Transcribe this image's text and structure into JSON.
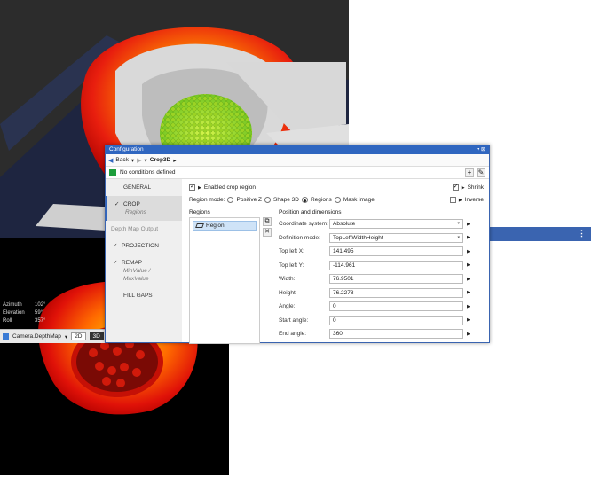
{
  "viewer": {
    "angles": [
      {
        "label": "Azimuth",
        "value": "102°"
      },
      {
        "label": "Elevation",
        "value": "59°"
      },
      {
        "label": "Roll",
        "value": "357°"
      }
    ],
    "camera_selector": "Camera.DepthMap",
    "mode_2d": "2D",
    "mode_3d": "3D",
    "active_mode": "3D"
  },
  "config": {
    "window_title": "Configuration",
    "back_label": "Back",
    "breadcrumb": "Crop3D",
    "conditions_label": "No conditions defined",
    "sidebar": [
      {
        "label": "GENERAL",
        "sub": "",
        "checked": false,
        "selected": false,
        "dim": false
      },
      {
        "label": "CROP",
        "sub": "Regions",
        "checked": true,
        "selected": true,
        "dim": false
      },
      {
        "label": "Depth Map Output",
        "sub": "",
        "checked": false,
        "selected": false,
        "dim": true
      },
      {
        "label": "PROJECTION",
        "sub": "",
        "checked": true,
        "selected": false,
        "dim": false
      },
      {
        "label": "REMAP",
        "sub": "MinValue / MaxValue",
        "checked": true,
        "selected": false,
        "dim": false
      },
      {
        "label": "FILL GAPS",
        "sub": "",
        "checked": false,
        "selected": false,
        "dim": false
      }
    ],
    "enabled_label": "Enabled crop region",
    "shrink_label": "Shrink",
    "inverse_label": "Inverse",
    "region_mode_label": "Region mode:",
    "region_modes": [
      "Positive Z",
      "Shape 3D",
      "Regions",
      "Mask image"
    ],
    "region_mode_selected": "Regions",
    "regions_header": "Regions",
    "region_items": [
      "Region"
    ],
    "posdim_header": "Position and dimensions",
    "fields": [
      {
        "label": "Coordinate system:",
        "value": "Absolute",
        "dropdown": true
      },
      {
        "label": "Definition mode:",
        "value": "TopLeftWidthHeight",
        "dropdown": true
      },
      {
        "label": "Top left X:",
        "value": "141.495",
        "dropdown": false
      },
      {
        "label": "Top left Y:",
        "value": "-114.961",
        "dropdown": false
      },
      {
        "label": "Width:",
        "value": "76.9501",
        "dropdown": false
      },
      {
        "label": "Height:",
        "value": "76.2278",
        "dropdown": false
      },
      {
        "label": "Angle:",
        "value": "0",
        "dropdown": false
      },
      {
        "label": "Start angle:",
        "value": "0",
        "dropdown": false
      },
      {
        "label": "End angle:",
        "value": "360",
        "dropdown": false
      }
    ]
  }
}
